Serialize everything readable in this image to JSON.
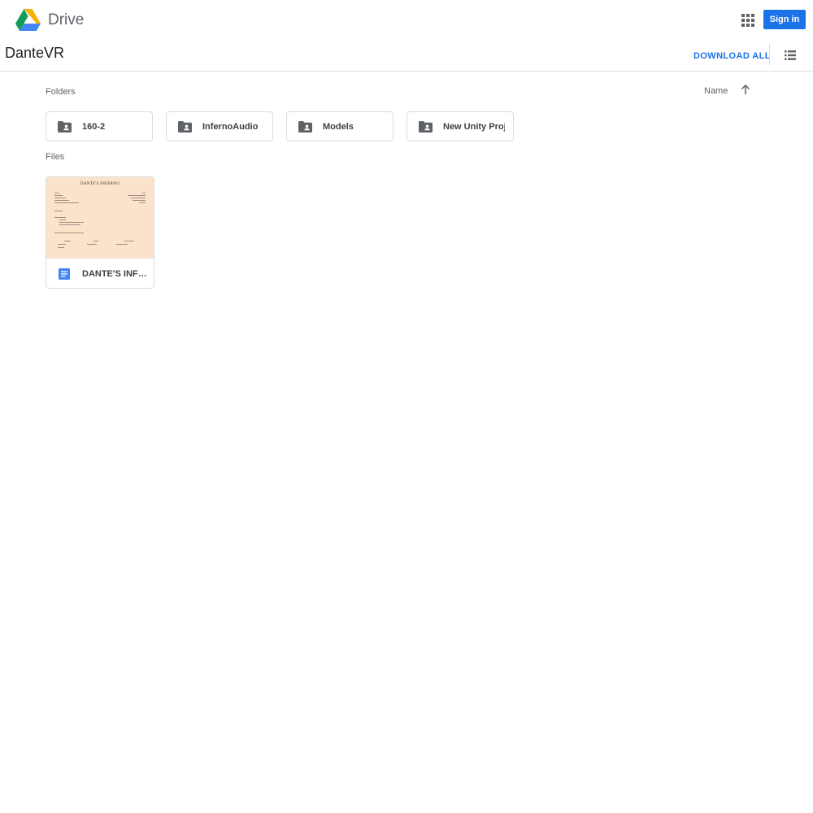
{
  "header": {
    "brand": "Drive",
    "signin_label": "Sign in",
    "brand_colors": {
      "green": "#0f9d58",
      "yellow": "#f4b400",
      "blue": "#4285f4",
      "accent": "#1a73e8"
    }
  },
  "titlebar": {
    "title": "DanteVR",
    "download_label": "DOWNLOAD ALL"
  },
  "folders_section": {
    "label": "Folders",
    "sort_label": "Name",
    "items": [
      {
        "name": "160-2",
        "icon": "shared-folder-icon"
      },
      {
        "name": "InfernoAudio",
        "icon": "shared-folder-icon"
      },
      {
        "name": "Models",
        "icon": "shared-folder-icon"
      },
      {
        "name": "New Unity Proj...",
        "icon": "shared-folder-icon"
      }
    ]
  },
  "files_section": {
    "label": "Files",
    "items": [
      {
        "name": "DANTE'S INFERNO",
        "icon": "google-doc-icon",
        "thumbnail_title": "DANTE'S INFERNO"
      }
    ]
  }
}
